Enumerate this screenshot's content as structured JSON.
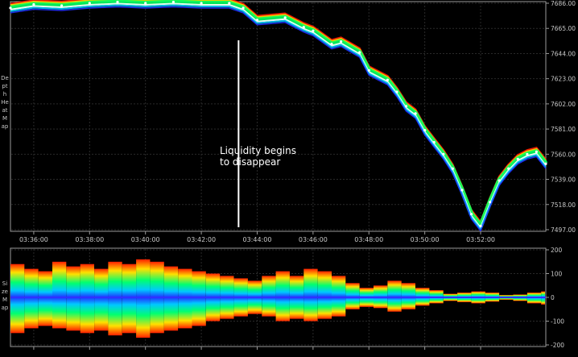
{
  "panels": {
    "top_side_label": "Depth Heat Map",
    "bottom_side_label": "Size Map"
  },
  "annotation": {
    "line1": "Liquidity begins",
    "line2": "to disappear",
    "time": "03:43:20"
  },
  "colors": {
    "background": "#000000",
    "grid": "#2a2a2a",
    "frame": "#9a9a9a",
    "tick_text": "#c8c8c8",
    "annotation": "#ffffff",
    "heat_low": "#2020ff",
    "heat_mid": "#00ff80",
    "heat_high": "#ff2000"
  },
  "chart_data": [
    {
      "type": "heatmap",
      "panel": "depth-heat-map",
      "x_tick_labels": [
        "03:36:00",
        "03:38:00",
        "03:40:00",
        "03:42:00",
        "03:44:00",
        "03:46:00",
        "03:48:00",
        "03:50:00",
        "03:52:00"
      ],
      "y_tick_labels": [
        "7686.00",
        "7665.00",
        "7644.00",
        "7623.00",
        "7602.00",
        "7581.00",
        "7560.00",
        "7539.00",
        "7518.00",
        "7497.00"
      ],
      "ylim": [
        7497,
        7686
      ],
      "grid": true,
      "price_series": {
        "x": [
          "03:35:10",
          "03:36:00",
          "03:37:00",
          "03:38:00",
          "03:39:00",
          "03:40:00",
          "03:41:00",
          "03:42:00",
          "03:43:00",
          "03:43:30",
          "03:44:00",
          "03:45:00",
          "03:45:40",
          "03:46:00",
          "03:46:40",
          "03:47:00",
          "03:47:40",
          "03:48:00",
          "03:48:40",
          "03:49:00",
          "03:49:20",
          "03:49:40",
          "03:50:00",
          "03:50:20",
          "03:50:40",
          "03:51:00",
          "03:51:20",
          "03:51:40",
          "03:52:00",
          "03:52:20",
          "03:52:40",
          "03:53:00",
          "03:53:20",
          "03:53:40",
          "03:54:00",
          "03:54:20"
        ],
        "y": [
          7682,
          7685,
          7684,
          7686,
          7687,
          7686,
          7687,
          7686,
          7686,
          7682,
          7672,
          7674,
          7666,
          7663,
          7652,
          7654,
          7645,
          7630,
          7622,
          7612,
          7600,
          7594,
          7580,
          7570,
          7560,
          7548,
          7530,
          7510,
          7500,
          7520,
          7538,
          7548,
          7556,
          7560,
          7562,
          7552
        ]
      }
    },
    {
      "type": "heatmap",
      "panel": "size-map",
      "x_tick_labels": [
        "03:36:00",
        "03:38:00",
        "03:40:00",
        "03:42:00",
        "03:44:00",
        "03:46:00",
        "03:48:00",
        "03:50:00",
        "03:52:00"
      ],
      "y_tick_labels": [
        "200",
        "100",
        "0",
        "-100",
        "-200"
      ],
      "ylim": [
        -200,
        200
      ],
      "grid": true,
      "size_series": {
        "x": [
          "03:35:10",
          "03:35:40",
          "03:36:10",
          "03:36:40",
          "03:37:10",
          "03:37:40",
          "03:38:10",
          "03:38:40",
          "03:39:10",
          "03:39:40",
          "03:40:10",
          "03:40:40",
          "03:41:10",
          "03:41:40",
          "03:42:10",
          "03:42:40",
          "03:43:10",
          "03:43:40",
          "03:44:10",
          "03:44:40",
          "03:45:10",
          "03:45:40",
          "03:46:10",
          "03:46:40",
          "03:47:10",
          "03:47:40",
          "03:48:10",
          "03:48:40",
          "03:49:10",
          "03:49:40",
          "03:50:10",
          "03:50:40",
          "03:51:10",
          "03:51:40",
          "03:52:10",
          "03:52:40",
          "03:53:10",
          "03:53:40",
          "03:54:10"
        ],
        "upper": [
          140,
          120,
          110,
          150,
          130,
          140,
          120,
          150,
          140,
          160,
          150,
          130,
          120,
          110,
          100,
          90,
          80,
          70,
          90,
          110,
          90,
          120,
          110,
          90,
          60,
          40,
          50,
          70,
          60,
          40,
          30,
          15,
          20,
          25,
          20,
          10,
          12,
          20,
          25
        ],
        "lower": [
          150,
          130,
          120,
          130,
          140,
          150,
          140,
          160,
          150,
          170,
          150,
          140,
          130,
          120,
          100,
          90,
          80,
          70,
          80,
          100,
          90,
          100,
          90,
          80,
          50,
          40,
          45,
          60,
          50,
          35,
          25,
          15,
          20,
          25,
          18,
          10,
          15,
          25,
          30
        ]
      }
    }
  ]
}
